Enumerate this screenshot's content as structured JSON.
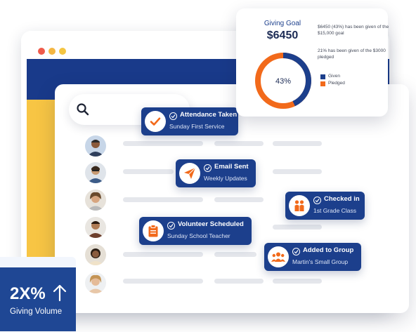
{
  "goal_card": {
    "label": "Giving Goal",
    "amount": "$6450",
    "note_given": "$6450 (43%) has been given of the $15,000 goal",
    "note_pledged": "21% has been given of the $3000 pledged",
    "percent_label": "43%",
    "given_fraction": 0.43,
    "legend": [
      {
        "label": "Given",
        "color": "#1c3f8c"
      },
      {
        "label": "Pledged",
        "color": "#f26a1b"
      }
    ]
  },
  "activity_cards": [
    {
      "title": "Attendance Taken",
      "subtitle": "Sunday First Service",
      "icon": "checkmark-icon"
    },
    {
      "title": "Email Sent",
      "subtitle": "Weekly Updates",
      "icon": "paper-plane-icon"
    },
    {
      "title": "Checked in",
      "subtitle": "1st Grade Class",
      "icon": "kids-icon"
    },
    {
      "title": "Volunteer Scheduled",
      "subtitle": "Sunday School Teacher",
      "icon": "clipboard-icon"
    },
    {
      "title": "Added to Group",
      "subtitle": "Martin's Small Group",
      "icon": "group-icon"
    }
  ],
  "stat": {
    "value": "2X%",
    "label": "Giving Volume",
    "icon": "arrow-up-icon"
  },
  "colors": {
    "brand_blue": "#1c3f8c",
    "accent_orange": "#f26a1b",
    "sidebar_yellow": "#f7c544"
  }
}
